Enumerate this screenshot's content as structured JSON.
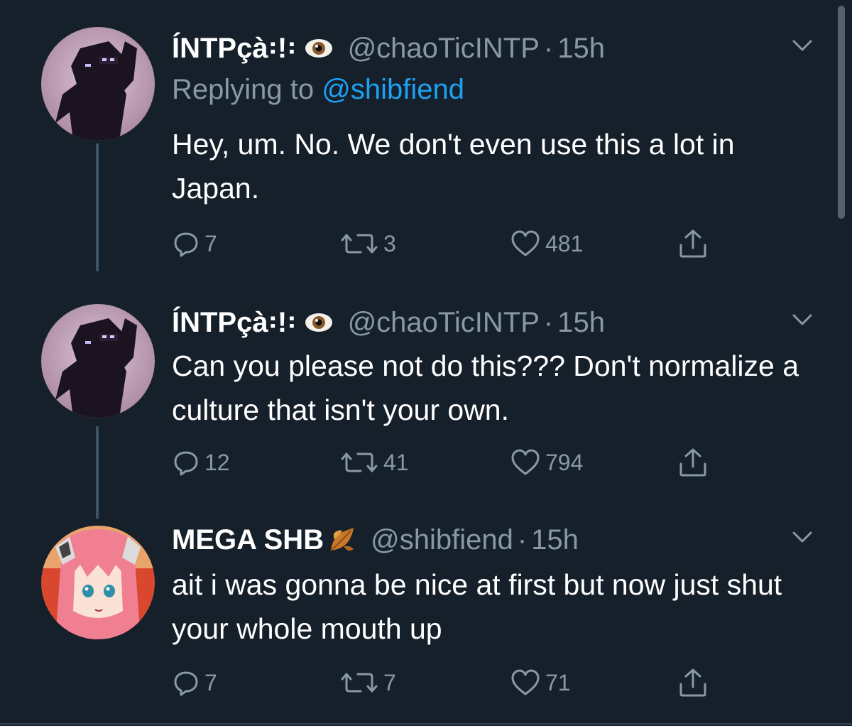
{
  "tweets": [
    {
      "display_name": "ÍNTPçà꞉!꞉",
      "emoji": "eye-emoji",
      "handle": "@chaoTicINTP",
      "separator": "·",
      "time": "15h",
      "replying_prefix": "Replying to",
      "replying_to": "@shibfiend",
      "text": "Hey, um. No. We don't even use this a lot in Japan.",
      "replies": "7",
      "retweets": "3",
      "likes": "481"
    },
    {
      "display_name": "ÍNTPçà꞉!꞉",
      "emoji": "eye-emoji",
      "handle": "@chaoTicINTP",
      "separator": "·",
      "time": "15h",
      "text": "Can you please not do this??? Don't normalize a culture that isn't your own.",
      "replies": "12",
      "retweets": "41",
      "likes": "794"
    },
    {
      "display_name": "MEGA SHB",
      "emoji": "fallen-leaf-emoji",
      "handle": "@shibfiend",
      "separator": "·",
      "time": "15h",
      "text": "ait i was gonna be nice at first but now just shut your whole mouth up",
      "replies": "7",
      "retweets": "7",
      "likes": "71"
    }
  ],
  "colors": {
    "background": "#15202b",
    "secondary_text": "#8899a6",
    "link": "#1da1f2",
    "thread_line": "#3d5466"
  }
}
